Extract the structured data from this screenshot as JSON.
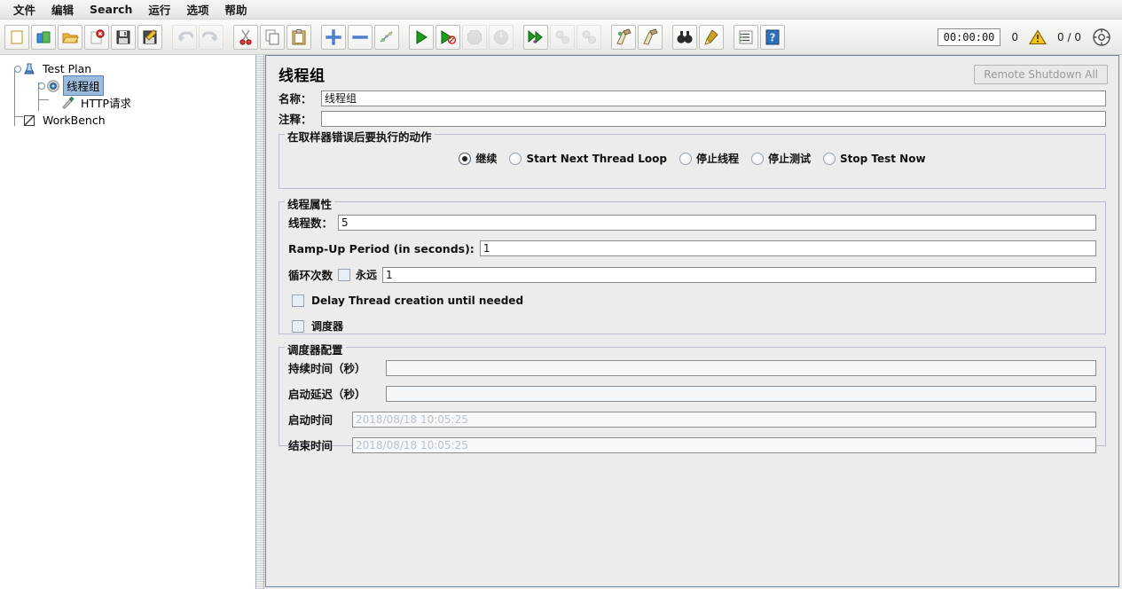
{
  "menu": {
    "items": [
      {
        "name": "menu-file",
        "label": "文件"
      },
      {
        "name": "menu-edit",
        "label": "编辑"
      },
      {
        "name": "menu-search",
        "label": "Search"
      },
      {
        "name": "menu-run",
        "label": "运行"
      },
      {
        "name": "menu-options",
        "label": "选项"
      },
      {
        "name": "menu-help",
        "label": "帮助"
      }
    ]
  },
  "toolbar": {
    "buttons": [
      {
        "name": "new-icon",
        "icon": "new",
        "enabled": true
      },
      {
        "name": "templates-icon",
        "icon": "templates",
        "enabled": true
      },
      {
        "name": "open-icon",
        "icon": "open",
        "enabled": true
      },
      {
        "name": "close-icon",
        "icon": "close",
        "enabled": true
      },
      {
        "name": "save-icon",
        "icon": "save",
        "enabled": true
      },
      {
        "name": "save-as-icon",
        "icon": "save-as",
        "enabled": true
      },
      {
        "name": "undo-icon",
        "icon": "undo",
        "enabled": false
      },
      {
        "name": "redo-icon",
        "icon": "redo",
        "enabled": false
      },
      {
        "name": "cut-icon",
        "icon": "cut",
        "enabled": true
      },
      {
        "name": "copy-icon",
        "icon": "copy",
        "enabled": true
      },
      {
        "name": "paste-icon",
        "icon": "paste",
        "enabled": true
      },
      {
        "name": "expand-all-icon",
        "icon": "plus",
        "enabled": true
      },
      {
        "name": "collapse-all-icon",
        "icon": "minus",
        "enabled": true
      },
      {
        "name": "toggle-icon",
        "icon": "toggle",
        "enabled": true
      },
      {
        "name": "start-icon",
        "icon": "start",
        "enabled": true
      },
      {
        "name": "start-no-pause-icon",
        "icon": "start-no-pause",
        "enabled": true
      },
      {
        "name": "stop-icon",
        "icon": "stop",
        "enabled": false
      },
      {
        "name": "shutdown-icon",
        "icon": "shutdown",
        "enabled": false
      },
      {
        "name": "remote-start-all-icon",
        "icon": "remote-start",
        "enabled": true
      },
      {
        "name": "remote-stop-all-icon",
        "icon": "remote-stop",
        "enabled": false
      },
      {
        "name": "remote-shutdown-all-icon",
        "icon": "remote-shut",
        "enabled": false
      },
      {
        "name": "clear-icon",
        "icon": "clear",
        "enabled": true
      },
      {
        "name": "clear-all-icon",
        "icon": "clear-all",
        "enabled": true
      },
      {
        "name": "search-icon",
        "icon": "binoculars",
        "enabled": true
      },
      {
        "name": "search-reset-icon",
        "icon": "brush",
        "enabled": true
      },
      {
        "name": "function-helper-icon",
        "icon": "list",
        "enabled": true
      },
      {
        "name": "help-icon",
        "icon": "help",
        "enabled": true
      }
    ],
    "status": {
      "timer": "00:00:00",
      "error_count": "0",
      "warning_icon": "warning-triangle-icon",
      "threads_running": "0 / 0",
      "connection_icon": "connection-icon"
    }
  },
  "tree": {
    "nodes": [
      {
        "name": "tree-node-test-plan",
        "label": "Test Plan",
        "icon": "test-plan-icon",
        "selected": false
      },
      {
        "name": "tree-node-thread-group",
        "label": "线程组",
        "icon": "thread-group-icon",
        "selected": true
      },
      {
        "name": "tree-node-http-request",
        "label": "HTTP请求",
        "icon": "http-request-icon",
        "selected": false
      },
      {
        "name": "tree-node-workbench",
        "label": "WorkBench",
        "icon": "workbench-icon",
        "selected": false
      }
    ]
  },
  "main": {
    "title": "线程组",
    "remote_shutdown_button": "Remote Shutdown All",
    "name_label": "名称：",
    "name_value": "线程组",
    "comment_label": "注释：",
    "comment_value": "",
    "error_action": {
      "title": "在取样器错误后要执行的动作",
      "options": [
        {
          "name": "radio-continue",
          "label": "继续",
          "checked": true
        },
        {
          "name": "radio-start-next-loop",
          "label": "Start Next Thread Loop",
          "checked": false
        },
        {
          "name": "radio-stop-thread",
          "label": "停止线程",
          "checked": false
        },
        {
          "name": "radio-stop-test",
          "label": "停止测试",
          "checked": false
        },
        {
          "name": "radio-stop-test-now",
          "label": "Stop Test Now",
          "checked": false
        }
      ]
    },
    "thread_properties": {
      "title": "线程属性",
      "num_threads_label": "线程数：",
      "num_threads_value": "5",
      "ramp_up_label": "Ramp-Up Period (in seconds):",
      "ramp_up_value": "1",
      "loop_count_label": "循环次数",
      "forever_label": "永远",
      "forever_checked": false,
      "loop_count_value": "1",
      "delay_thread_label": "Delay Thread creation until needed",
      "delay_thread_checked": false,
      "scheduler_label": "调度器",
      "scheduler_checked": false
    },
    "scheduler_config": {
      "title": "调度器配置",
      "duration_label": "持续时间（秒）",
      "duration_value": "",
      "startup_delay_label": "启动延迟（秒）",
      "startup_delay_value": "",
      "start_time_label": "启动时间",
      "start_time_value": "2018/08/18 10:05:25",
      "end_time_label": "结束时间",
      "end_time_value": "2018/08/18 10:05:25"
    }
  },
  "colors": {
    "selection": "#9bbbdd",
    "panel_border": "#6f86a8",
    "group_border": "#b9bcd0",
    "background": "#ececec",
    "warning": "#f5c518"
  }
}
